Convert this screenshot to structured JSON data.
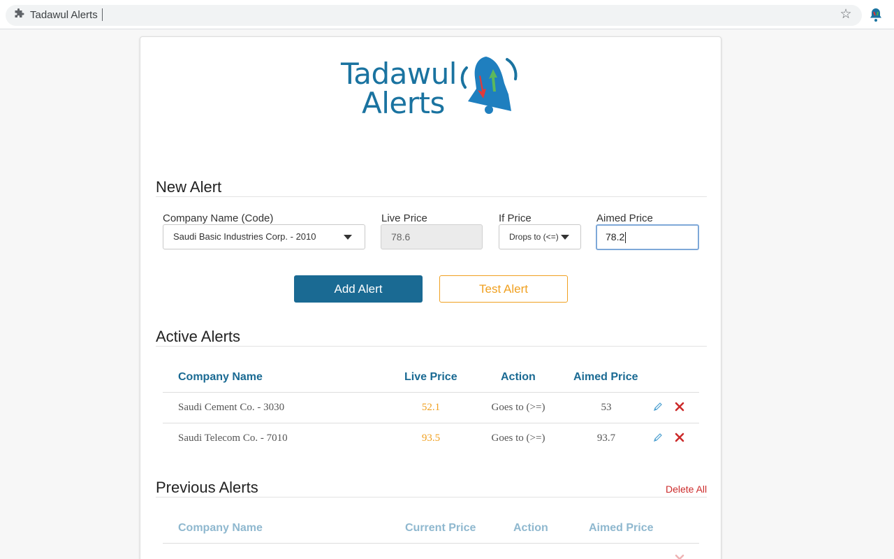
{
  "browser": {
    "tab_title": "Tadawul Alerts"
  },
  "logo": {
    "line1": "Tadawul",
    "line2": "Alerts"
  },
  "new_alert": {
    "title": "New Alert",
    "company_label": "Company Name (Code)",
    "company_value": "Saudi Basic Industries Corp. - 2010",
    "live_price_label": "Live Price",
    "live_price_value": "78.6",
    "if_price_label": "If Price",
    "if_price_value": "Drops to (<=)",
    "aimed_price_label": "Aimed Price",
    "aimed_price_value": "78.2",
    "add_button": "Add Alert",
    "test_button": "Test Alert"
  },
  "active_alerts": {
    "title": "Active Alerts",
    "headers": [
      "Company Name",
      "Live Price",
      "Action",
      "Aimed Price"
    ],
    "rows": [
      {
        "company": "Saudi Cement Co. - 3030",
        "live_price": "52.1",
        "action": "Goes to (>=)",
        "aimed_price": "53"
      },
      {
        "company": "Saudi Telecom Co. - 7010",
        "live_price": "93.5",
        "action": "Goes to (>=)",
        "aimed_price": "93.7"
      }
    ]
  },
  "previous_alerts": {
    "title": "Previous Alerts",
    "delete_all": "Delete All",
    "headers": [
      "Company Name",
      "Current Price",
      "Action",
      "Aimed Price"
    ]
  },
  "colors": {
    "primary": "#1a6a93",
    "accent": "#f0a020",
    "danger": "#cc2b2b"
  },
  "icons": [
    "puzzle-icon",
    "star-icon",
    "bell-extension-icon",
    "edit-icon",
    "delete-icon"
  ]
}
